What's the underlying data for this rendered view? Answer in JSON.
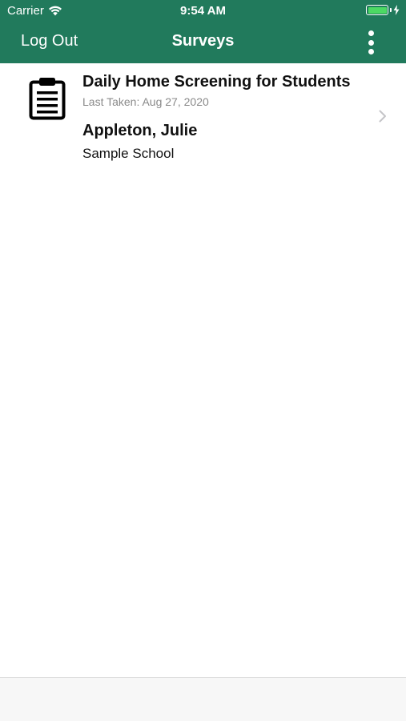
{
  "status_bar": {
    "carrier": "Carrier",
    "time": "9:54 AM",
    "battery_level": 1.0,
    "battery_color": "#4cd964"
  },
  "nav": {
    "logout_label": "Log Out",
    "title": "Surveys",
    "menu_icon": "more-vertical-icon",
    "background_color": "#217a5c"
  },
  "surveys": [
    {
      "icon": "clipboard-icon",
      "title": "Daily Home Screening for Students",
      "last_taken": "Last Taken: Aug 27, 2020",
      "student_name": "Appleton, Julie",
      "school": "Sample School"
    }
  ]
}
